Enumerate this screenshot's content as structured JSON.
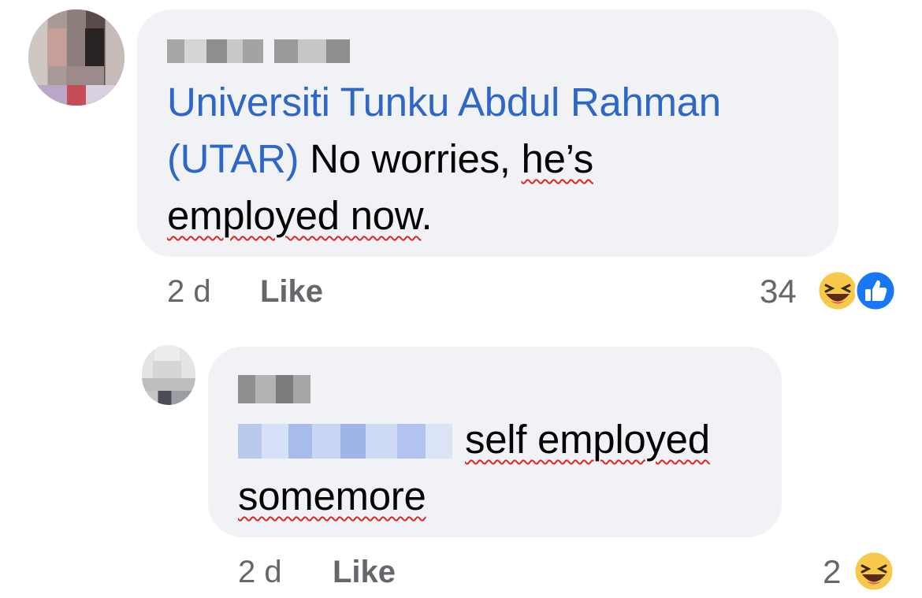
{
  "comments": [
    {
      "author_name_redacted": true,
      "mention": "Universiti Tunku Abdul Rahman",
      "mention_cont": "(UTAR)",
      "text_part1": " No worries, ",
      "text_misspelled1": "he’s",
      "text_line3": "employed now",
      "text_period": ".",
      "time": "2 d",
      "like_label": "Like",
      "reaction_count": "34",
      "reactions": [
        "haha-icon",
        "like-icon"
      ]
    },
    {
      "author_name_redacted": true,
      "mention_redacted": true,
      "text_part1": "self employed",
      "text_line2": "somemore",
      "time": "2 d",
      "like_label": "Like",
      "reaction_count": "2",
      "reactions": [
        "haha-icon"
      ]
    }
  ],
  "colors": {
    "mention": "#2f67c9",
    "bubble": "#f0f2f5",
    "meta": "#65676b",
    "like_blue": "#1877f2",
    "haha_yellow": "#f7c84a",
    "spellcheck_red": "#e02424"
  }
}
